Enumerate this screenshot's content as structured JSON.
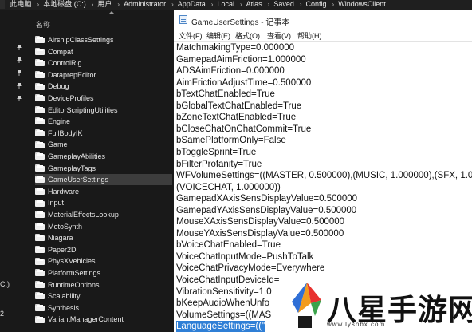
{
  "breadcrumb": {
    "items": [
      "此电脑",
      "本地磁盘 (C:)",
      "用户",
      "Administrator",
      "AppData",
      "Local",
      "Atlas",
      "Saved",
      "Config",
      "WindowsClient"
    ],
    "separator": "›"
  },
  "nav": {
    "label_c": "C:)",
    "label_2": "2"
  },
  "file_list": {
    "column_header": "名称",
    "items": [
      "AirshipClassSettings",
      "Compat",
      "ControlRig",
      "DataprepEditor",
      "Debug",
      "DeviceProfiles",
      "EditorScriptingUtilities",
      "Engine",
      "FullBodyIK",
      "Game",
      "GameplayAbilities",
      "GameplayTags",
      "GameUserSettings",
      "Hardware",
      "Input",
      "MaterialEffectsLookup",
      "MotoSynth",
      "Niagara",
      "Paper2D",
      "PhysXVehicles",
      "PlatformSettings",
      "RuntimeOptions",
      "Scalability",
      "Synthesis",
      "VariantManagerContent"
    ],
    "selected_item": "GameUserSettings"
  },
  "notepad": {
    "title": "GameUserSettings - 记事本",
    "menu": [
      "文件(F)",
      "编辑(E)",
      "格式(O)",
      "查看(V)",
      "帮助(H)"
    ],
    "lines": [
      "MatchmakingType=0.000000",
      "GamepadAimFriction=1.000000",
      "ADSAimFriction=0.000000",
      "AimFrictionAdjustTime=0.500000",
      "bTextChatEnabled=True",
      "bGlobalTextChatEnabled=True",
      "bZoneTextChatEnabled=True",
      "bCloseChatOnChatCommit=True",
      "bSamePlatformOnly=False",
      "bToggleSprint=True",
      "bFilterProfanity=True",
      "WFVolumeSettings=((MASTER, 0.500000),(MUSIC, 1.000000),(SFX, 1.0",
      "(VOICECHAT, 1.000000))",
      "GamepadXAxisSensDisplayValue=0.500000",
      "GamepadYAxisSensDisplayValue=0.500000",
      "MouseXAxisSensDisplayValue=0.500000",
      "MouseYAxisSensDisplayValue=0.500000",
      "bVoiceChatEnabled=True",
      "VoiceChatInputMode=PushToTalk",
      "VoiceChatPrivacyMode=Everywhere",
      "VoiceChatInputDeviceId=",
      "VibrationSensitivity=1.0",
      "bKeepAudioWhenUnfo",
      "VolumeSettings=((MAS",
      "LanguageSettings=((\""
    ],
    "highlighted_line": "LanguageSettings=((\""
  },
  "watermark": {
    "text": "八星手游网",
    "url": "www.lyshbx.com",
    "colors": {
      "red": "#e8312f",
      "orange": "#f29b1d",
      "blue": "#2f6fd6",
      "green": "#3aa34a"
    }
  },
  "colors": {
    "explorer_bg": "#191919",
    "selection_bg": "#3d3d3d",
    "text_highlight": "#2f7fd6"
  }
}
